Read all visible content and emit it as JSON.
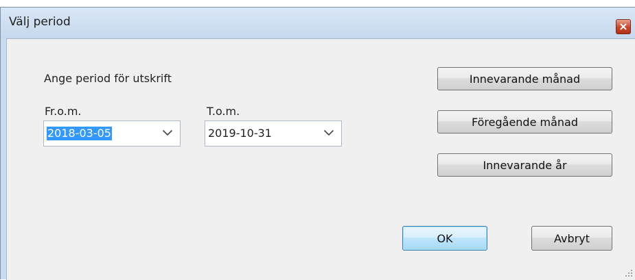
{
  "window": {
    "title": "Välj period"
  },
  "dialog": {
    "prompt": "Ange period för utskrift",
    "from_label": "Fr.o.m.",
    "from_value": "2018-03-05",
    "to_label": "T.o.m.",
    "to_value": "2019-10-31"
  },
  "buttons": {
    "current_month": "Innevarande månad",
    "previous_month": "Föregående månad",
    "current_year": "Innevarande år",
    "ok": "OK",
    "cancel": "Avbryt"
  },
  "icons": {
    "close": "close-icon",
    "dropdown": "chevron-down-icon",
    "grip": "resize-grip-icon"
  },
  "colors": {
    "selection": "#3399ff",
    "close_button": "#c9452a",
    "default_button_border": "#3c7fb1"
  }
}
